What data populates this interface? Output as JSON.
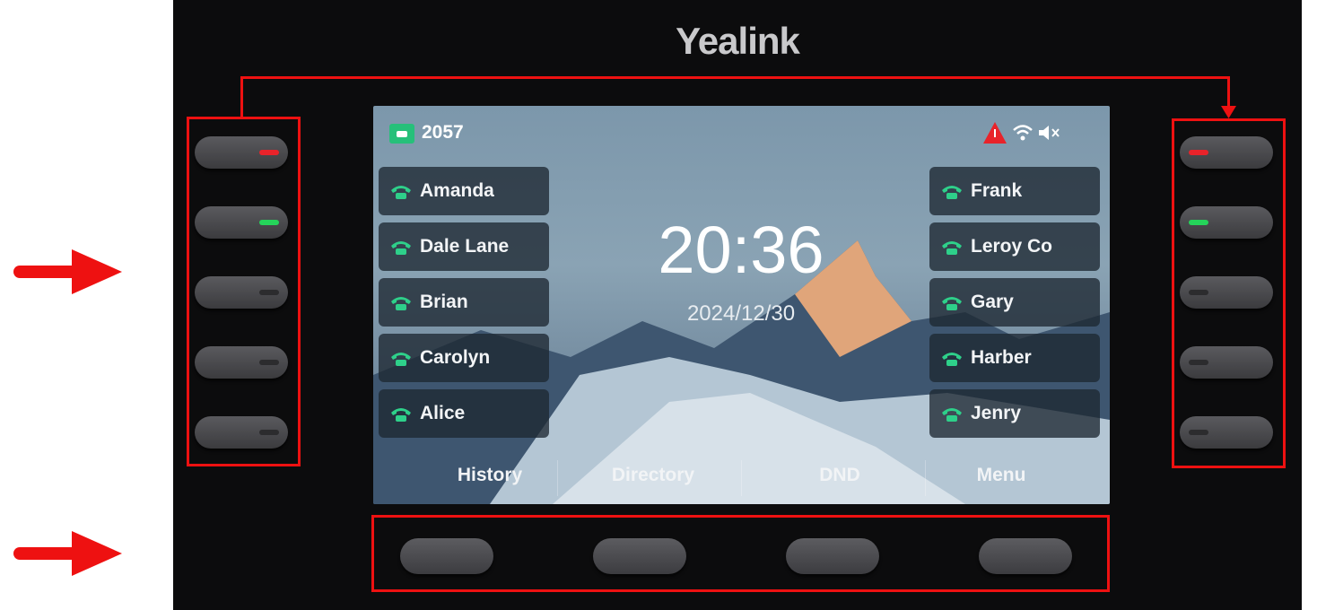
{
  "device": {
    "brand": "Yealink"
  },
  "status_bar": {
    "extension": "2057",
    "icons": [
      "alert-icon",
      "wifi-icon",
      "mute-icon"
    ]
  },
  "line_keys_left": [
    {
      "label": "Amanda"
    },
    {
      "label": "Dale Lane"
    },
    {
      "label": "Brian"
    },
    {
      "label": "Carolyn"
    },
    {
      "label": "Alice"
    }
  ],
  "line_keys_right": [
    {
      "label": "Frank"
    },
    {
      "label": "Leroy Co"
    },
    {
      "label": "Gary"
    },
    {
      "label": "Harber"
    },
    {
      "label": "Jenry"
    }
  ],
  "clock": {
    "time": "20:36",
    "date": "2024/12/30"
  },
  "softkeys": [
    {
      "label": "History"
    },
    {
      "label": "Directory"
    },
    {
      "label": "DND"
    },
    {
      "label": "Menu"
    }
  ],
  "led_colors": {
    "red": "#e8232a",
    "green": "#25d45a",
    "off": "#2c2c2e"
  },
  "annotation_color": "#ee1111"
}
